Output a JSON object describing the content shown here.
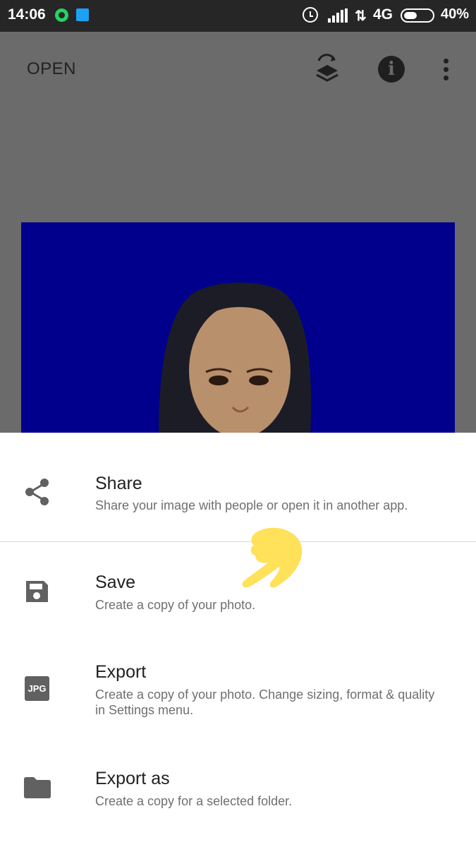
{
  "status_bar": {
    "time": "14:06",
    "network": "4G",
    "battery": "40%",
    "icons": [
      "whatsapp-icon",
      "twitter-icon",
      "alarm-icon",
      "signal-icon",
      "data-arrows-icon",
      "battery-icon"
    ]
  },
  "toolbar": {
    "open_label": "OPEN",
    "icons": [
      "layers-icon",
      "info-icon",
      "more-vert-icon"
    ]
  },
  "sheet": {
    "items": [
      {
        "title": "Share",
        "description": "Share your image with people or open it in another app.",
        "icon": "share-icon"
      },
      {
        "title": "Save",
        "description": "Create a copy of your photo.",
        "icon": "save-icon"
      },
      {
        "title": "Export",
        "description": "Create a copy of your photo. Change sizing, format & quality in Settings menu.",
        "icon": "jpg-icon",
        "icon_text": "JPG"
      },
      {
        "title": "Export as",
        "description": "Create a copy for a selected folder.",
        "icon": "folder-icon"
      }
    ]
  },
  "colors": {
    "status_bar": "#262626",
    "dim_overlay": "#6b6b6b",
    "photo_background": "#00008c",
    "sheet": "#ffffff",
    "icon_gray": "#616161",
    "annotation": "#ffe15a"
  }
}
